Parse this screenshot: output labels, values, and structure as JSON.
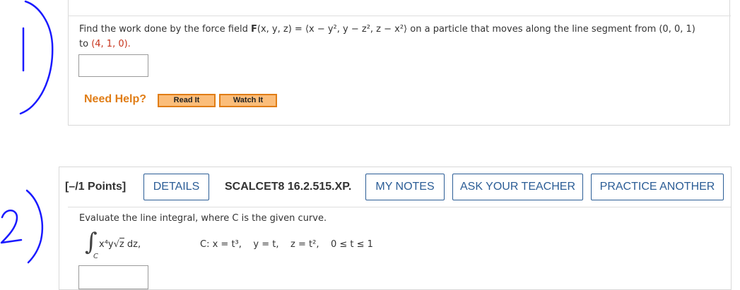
{
  "question1": {
    "prompt_before": "Find the work done by the force field ",
    "field_name": "F",
    "field_expr": "(x, y, z) = ⟨x − y², y − z², z − x²⟩",
    "prompt_mid": " on a particle that moves along the line segment from ",
    "start_point": "(0, 0, 1)",
    "prompt_to": "to ",
    "end_point": "(4, 1, 0).",
    "answer_value": "",
    "need_help_label": "Need Help?",
    "read_it_label": "Read It",
    "watch_it_label": "Watch It"
  },
  "question2": {
    "points_label": "[–/1 Points]",
    "details_label": "DETAILS",
    "problem_code": "SCALCET8 16.2.515.XP.",
    "my_notes_label": "MY NOTES",
    "ask_teacher_label": "ASK YOUR TEACHER",
    "practice_another_label": "PRACTICE ANOTHER",
    "prompt": "Evaluate the line integral, where C is the given curve.",
    "integral_symbol": "∫",
    "integral_subscript": "C",
    "integrand_pre": "x⁴y",
    "integrand_sqrt": "√",
    "integrand_radicand": "z",
    "integrand_post": " dz,",
    "curve_c": "C: x = t³,",
    "curve_y": "y = t,",
    "curve_z": "z = t²,",
    "curve_range": "0 ≤ t ≤ 1",
    "answer_value": ""
  },
  "annotations": {
    "mark1": "1)",
    "mark2": "2)",
    "ink_color": "#1a1aff"
  },
  "colors": {
    "help_orange": "#e07d16",
    "button_blue": "#2b5d96",
    "point_red": "#c7331b"
  }
}
